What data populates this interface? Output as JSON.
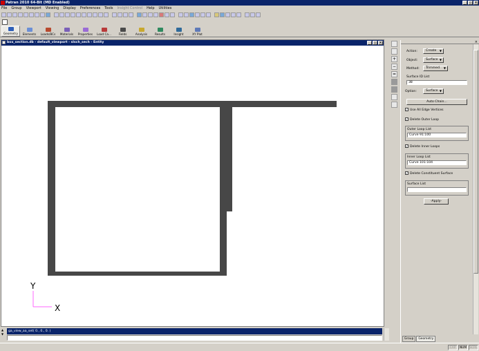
{
  "window": {
    "title": "Patran 2010 64-Bit (MD Enabled)",
    "minimize": "_",
    "restore": "▫",
    "close": "×"
  },
  "menu": [
    "File",
    "Group",
    "Viewport",
    "Viewing",
    "Display",
    "Preferences",
    "Tools",
    "Insight Control",
    "Help",
    "Utilities"
  ],
  "menu_disabled_index": 7,
  "app_tabs": [
    "Geometry",
    "Elements",
    "Loads/BCs",
    "Materials",
    "Properties",
    "Load Ca...",
    "Fields",
    "Analysis",
    "Results",
    "Insight",
    "XY Plot"
  ],
  "viewport": {
    "title": "box_section.db - default_viewport - slsch_sech - Entity"
  },
  "triad": {
    "y_label": "Y",
    "x_label": "X"
  },
  "panel": {
    "close": "×",
    "action_label": "Action:",
    "action_value": "Create",
    "object_label": "Object:",
    "object_value": "Surface",
    "method_label": "Method:",
    "method_value": "Trimmed",
    "surface_id_label": "Surface ID List",
    "surface_id_value": "38",
    "option_label": "Option:",
    "option_value": "Surface",
    "auto_chain_button": "Auto Chain...",
    "use_all_edge_vertices": "Use All Edge Vertices",
    "delete_outer_loop": "Delete Outer Loop",
    "outer_loop_label": "Outer Loop List",
    "outer_loop_value": "Curve 91:100",
    "delete_inner_loops": "Delete Inner Loops",
    "inner_loop_label": "Inner Loop List",
    "inner_loop_value": "Curve 101:104",
    "delete_constituent_surface": "Delete Constituent Surface",
    "surface_list_label": "Surface List",
    "surface_list_value": "",
    "apply_button": "-Apply-",
    "tabs": [
      "Group",
      "Geometry"
    ]
  },
  "command": {
    "history": "ga_view_aa_set( 0., 0., 0. )",
    "input": ""
  },
  "status": [
    "CAP",
    "NUM",
    "SCRL"
  ],
  "colors": {
    "titlebar": "#0a246a",
    "viewport_bg": "#ffffff",
    "section_fill": "#474747",
    "triad": "#ff66ff"
  }
}
